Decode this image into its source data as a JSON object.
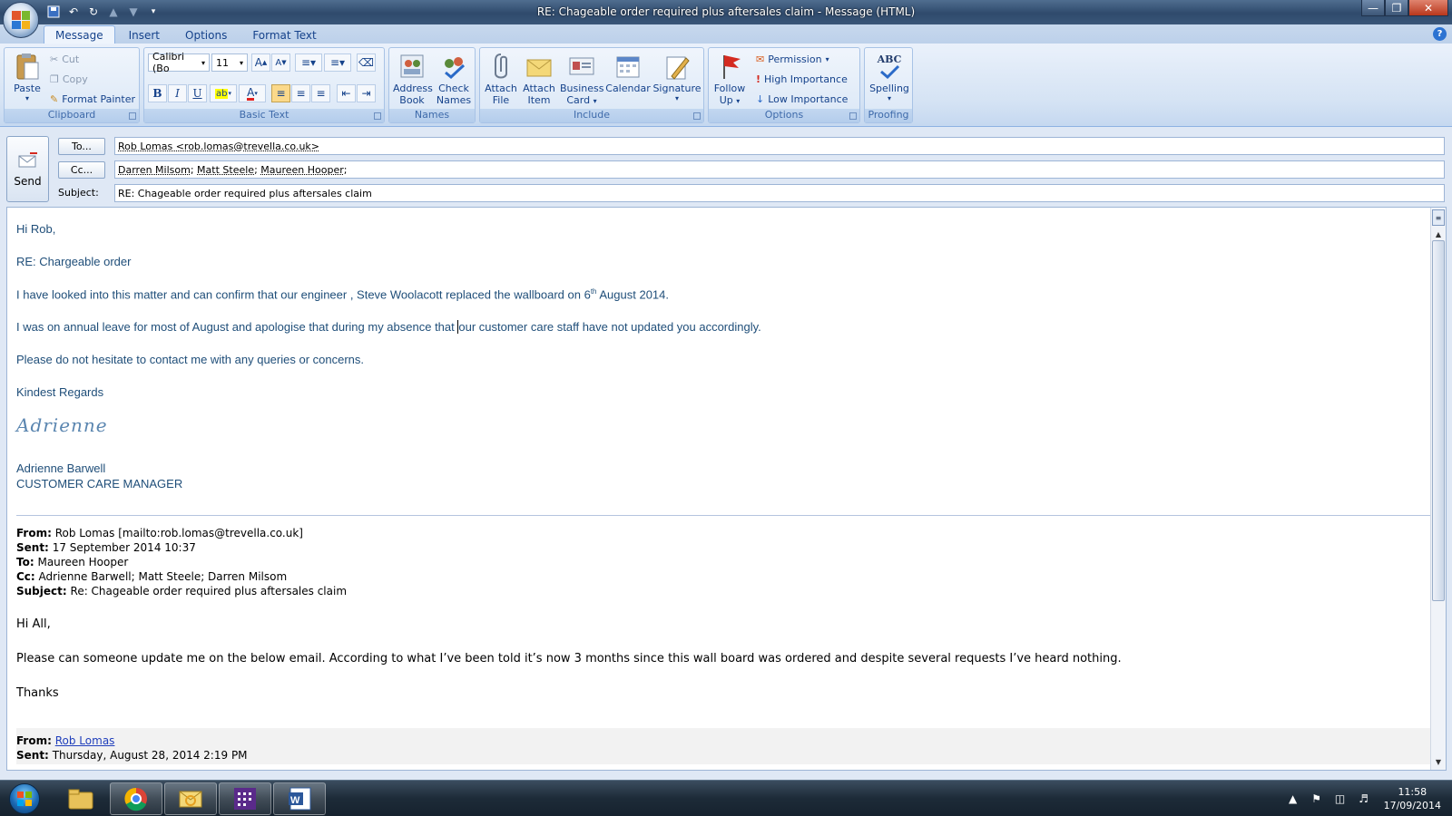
{
  "window": {
    "title": "RE: Chageable order required plus aftersales claim - Message (HTML)"
  },
  "ribbon_tabs": [
    "Message",
    "Insert",
    "Options",
    "Format Text"
  ],
  "ribbon": {
    "clipboard": {
      "paste": "Paste",
      "cut": "Cut",
      "copy": "Copy",
      "format_painter": "Format Painter",
      "label": "Clipboard"
    },
    "basic_text": {
      "font_name": "Calibri (Bo",
      "font_size": "11",
      "bold": "B",
      "italic": "I",
      "underline": "U",
      "label": "Basic Text"
    },
    "names": {
      "address_book_1": "Address",
      "address_book_2": "Book",
      "check_names_1": "Check",
      "check_names_2": "Names",
      "label": "Names"
    },
    "include": {
      "attach_file_1": "Attach",
      "attach_file_2": "File",
      "attach_item_1": "Attach",
      "attach_item_2": "Item",
      "business_card_1": "Business",
      "business_card_2": "Card",
      "calendar": "Calendar",
      "signature": "Signature",
      "label": "Include"
    },
    "options": {
      "follow_up_1": "Follow",
      "follow_up_2": "Up",
      "permission": "Permission",
      "high_importance": "High Importance",
      "low_importance": "Low Importance",
      "label": "Options"
    },
    "proofing": {
      "spelling": "Spelling",
      "abc": "ABC",
      "label": "Proofing"
    }
  },
  "compose": {
    "send": "Send",
    "to_button": "To...",
    "cc_button": "Cc...",
    "subject_label": "Subject:",
    "to_value": "Rob Lomas <rob.lomas@trevella.co.uk>",
    "cc_values": [
      "Darren Milsom",
      "Matt Steele",
      "Maureen Hooper"
    ],
    "subject_value": "RE: Chageable order required plus aftersales claim"
  },
  "body": {
    "greeting": "Hi Rob,",
    "re_line": "RE: Chargeable order",
    "para1_before": "I have looked into this matter and can confirm that our engineer , Steve Woolacott replaced the wallboard on 6",
    "para1_sup": "th",
    "para1_after": " August 2014.",
    "para2_before": "I was on annual leave for most of August and apologise that during my absence that ",
    "para2_after": "our customer care staff have not updated you accordingly.",
    "para3": "Please do not hesitate to contact me with any queries or concerns.",
    "closing": "Kindest Regards",
    "signature_script": "Adrienne",
    "sig_name": "Adrienne Barwell",
    "sig_title": "CUSTOMER CARE MANAGER",
    "quoted": {
      "from_label": "From:",
      "from": "Rob Lomas [mailto:rob.lomas@trevella.co.uk]",
      "sent_label": "Sent:",
      "sent": "17 September 2014 10:37",
      "to_label": "To:",
      "to": "Maureen Hooper",
      "cc_label": "Cc:",
      "cc": "Adrienne Barwell; Matt Steele; Darren Milsom",
      "subject_label": "Subject:",
      "subject": "Re: Chageable order required plus aftersales claim",
      "greeting": "Hi All,",
      "para": "Please can someone update me on the below email. According to what I’ve been told it’s now 3 months since this wall board was ordered and despite several requests I’ve heard nothing.",
      "thanks": "Thanks"
    },
    "quoted2": {
      "from_label": "From:",
      "from": "Rob Lomas",
      "sent_label": "Sent:",
      "sent": "Thursday, August 28, 2014 2:19 PM"
    }
  },
  "taskbar": {
    "apps": [
      "windows-explorer",
      "google-chrome",
      "outlook",
      "calendar-app",
      "microsoft-word"
    ],
    "time": "11:58",
    "date": "17/09/2014"
  }
}
